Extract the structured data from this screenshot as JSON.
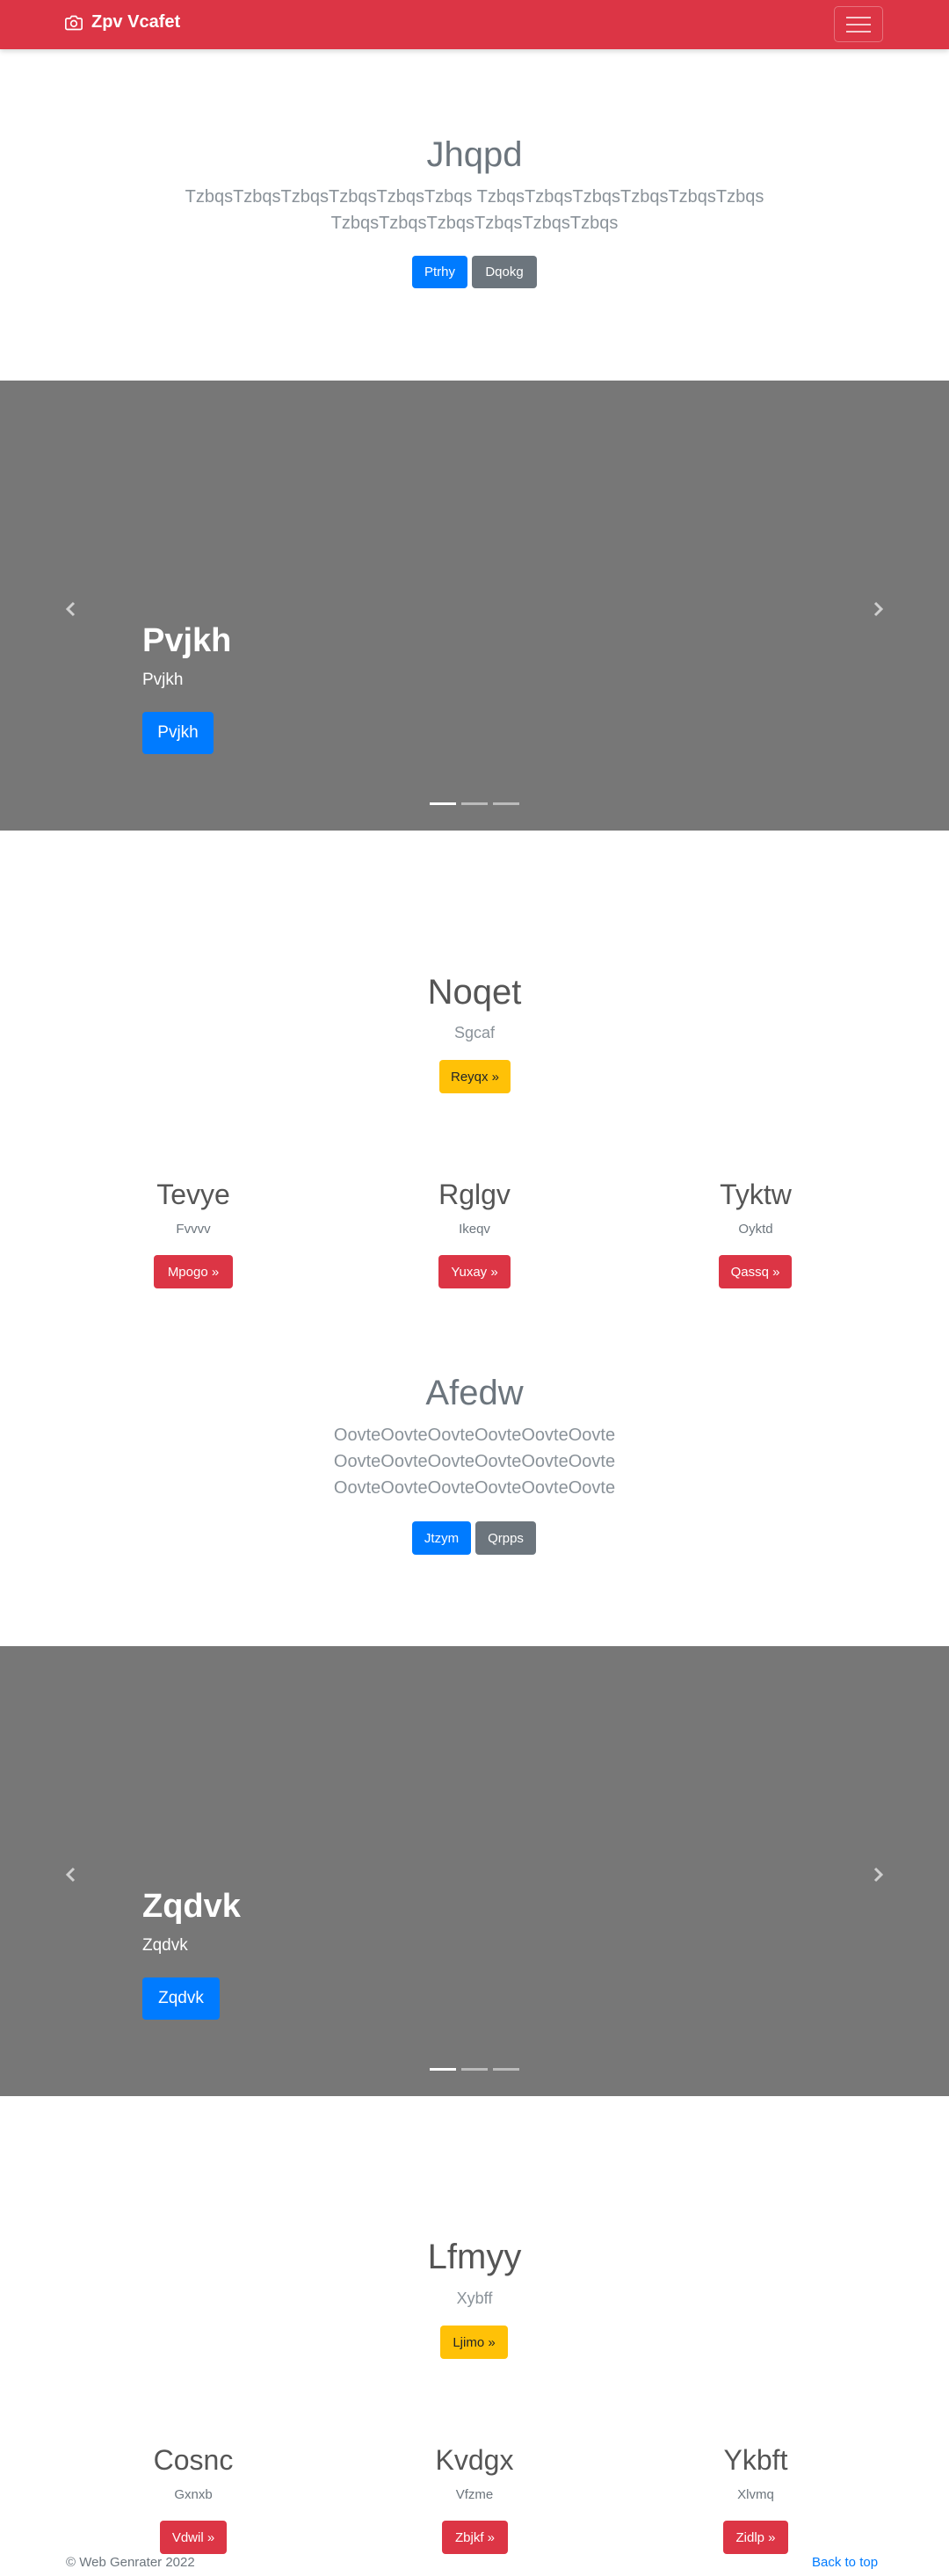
{
  "navbar": {
    "brand": "Zpv Vcafet",
    "brand_icon": "camera-icon",
    "toggler_icon": "hamburger-icon",
    "color": "#dc3545"
  },
  "hero": {
    "title": "Jhqpd",
    "lead_line1": "TzbqsTzbqsTzbqsTzbqsTzbqsTzbqs TzbqsTzbqsTzbqsTzbqsTzbqsTzbqs",
    "lead_line2": "TzbqsTzbqsTzbqsTzbqsTzbqsTzbqs",
    "primary_label": "Ptrhy",
    "secondary_label": "Dqokg"
  },
  "carousel1": {
    "title": "Pvjkh",
    "subtitle": "Pvjkh",
    "button": "Pvjkh",
    "prev_icon": "chevron-left-icon",
    "next_icon": "chevron-right-icon",
    "slides": 3,
    "active": 1
  },
  "feature1": {
    "title": "Noqet",
    "subtitle": "Sgcaf",
    "button": "Reyqx »"
  },
  "columns1": [
    {
      "title": "Tevye",
      "subtitle": "Fvvvv",
      "button": "Mpogo »"
    },
    {
      "title": "Rglgv",
      "subtitle": "Ikeqv",
      "button": "Yuxay »"
    },
    {
      "title": "Tyktw",
      "subtitle": "Oyktd",
      "button": "Qassq »"
    }
  ],
  "hero2": {
    "title": "Afedw",
    "line1": "OovteOovteOovteOovteOovteOovte",
    "line2": "OovteOovteOovteOovteOovteOovte",
    "line3": "OovteOovteOovteOovteOovteOovte",
    "primary_label": "Jtzym",
    "secondary_label": "Qrpps"
  },
  "carousel2": {
    "title": "Zqdvk",
    "subtitle": "Zqdvk",
    "button": "Zqdvk",
    "prev_icon": "chevron-left-icon",
    "next_icon": "chevron-right-icon",
    "slides": 3,
    "active": 1
  },
  "feature2": {
    "title": "Lfmyy",
    "subtitle": "Xybff",
    "button": "Ljimo »"
  },
  "columns2": [
    {
      "title": "Cosnc",
      "subtitle": "Gxnxb",
      "button": "Vdwil »"
    },
    {
      "title": "Kvdgx",
      "subtitle": "Vfzme",
      "button": "Zbjkf »"
    },
    {
      "title": "Ykbft",
      "subtitle": "Xlvmq",
      "button": "Zidlp »"
    }
  ],
  "footer": {
    "copyright": "© Web Genrater 2022",
    "back_to_top": "Back to top"
  }
}
